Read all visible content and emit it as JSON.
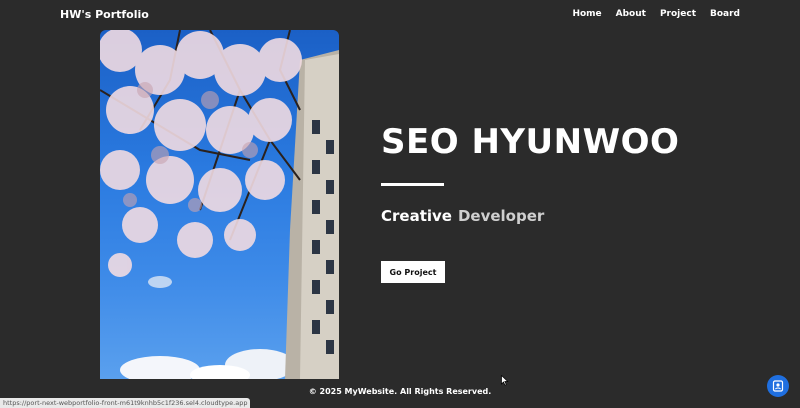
{
  "nav": {
    "brand": "HW's Portfolio",
    "links": [
      "Home",
      "About",
      "Project",
      "Board"
    ]
  },
  "hero": {
    "title": "SEO HYUNWOO",
    "subtitle_word1": "Creative",
    "subtitle_word2": "Developer",
    "button_label": "Go Project"
  },
  "footer": {
    "text": "© 2025 MyWebsite. All Rights Reserved."
  },
  "status_bar": {
    "url": "https://port-next-webportfolio-front-m61t9knhb5c1f236.sel4.cloudtype.app"
  },
  "icons": {
    "fab": "contact-card-icon",
    "cursor": "mouse-pointer-icon"
  },
  "colors": {
    "background": "#2b2b2b",
    "fab": "#1f6fe0",
    "sky": "#2a7ae0"
  }
}
